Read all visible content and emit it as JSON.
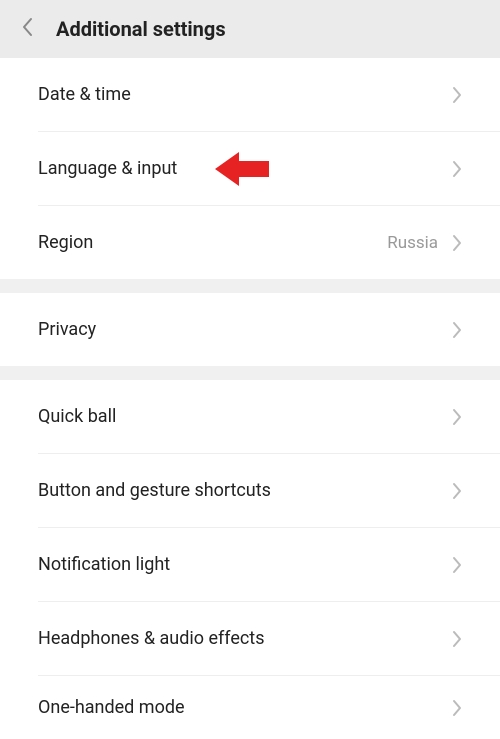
{
  "header": {
    "title": "Additional settings"
  },
  "sections": [
    {
      "rows": [
        {
          "label": "Date & time",
          "value": ""
        },
        {
          "label": "Language & input",
          "value": ""
        },
        {
          "label": "Region",
          "value": "Russia"
        }
      ]
    },
    {
      "rows": [
        {
          "label": "Privacy",
          "value": ""
        }
      ]
    },
    {
      "rows": [
        {
          "label": "Quick ball",
          "value": ""
        },
        {
          "label": "Button and gesture shortcuts",
          "value": ""
        },
        {
          "label": "Notification light",
          "value": ""
        },
        {
          "label": "Headphones & audio effects",
          "value": ""
        },
        {
          "label": "One-handed mode",
          "value": ""
        }
      ]
    }
  ],
  "colors": {
    "arrow": "#e62222"
  }
}
